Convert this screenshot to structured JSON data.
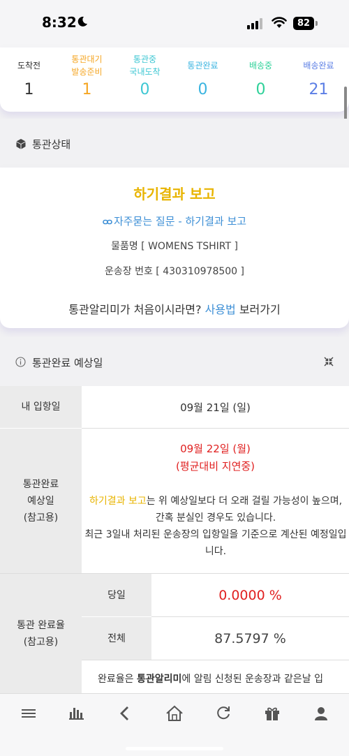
{
  "status_bar": {
    "time": "8:32",
    "battery": "82"
  },
  "stats": [
    {
      "label": "도착전",
      "value": "1",
      "color": "#333333"
    },
    {
      "label": "통관대기\n발송준비",
      "value": "1",
      "color": "#f5a623"
    },
    {
      "label": "통관중\n국내도착",
      "value": "0",
      "color": "#3ec7d3"
    },
    {
      "label": "통관완료",
      "value": "0",
      "color": "#3ab4e0"
    },
    {
      "label": "배송중",
      "value": "0",
      "color": "#2fd199"
    },
    {
      "label": "배송완료",
      "value": "21",
      "color": "#5b7ee5"
    }
  ],
  "status_section": {
    "header": "통관상태",
    "title": "하기결과 보고",
    "faq_link": "자주묻는 질문 - 하기결과 보고",
    "item_name": "물품명 [ WOMENS TSHIRT ]",
    "tracking": "운송장 번호 [ 430310978500 ]",
    "guide_prefix": "통관알리미가 처음이시라면? ",
    "guide_link": "사용법",
    "guide_suffix": " 보러가기"
  },
  "estimate_section": {
    "header": "통관완료 예상일",
    "arrival_label": "내 입항일",
    "arrival_value": "09월 21일 (일)",
    "estimate_label": "통관완료\n예상일\n(참고용)",
    "estimate_date": "09월 22일 (월)",
    "estimate_delay": "(평균대비 지연중)",
    "note_highlight": "하기결과 보고",
    "note_text": "는 위 예상일보다 더 오래 걸릴 가능성이 높으며, 간혹 분실인 경우도 있습니다.",
    "note_text2": "최근 3일내 처리된 운송장의 입항일을 기준으로 계산된 예정일입니다.",
    "rate_label": "통관 완료율\n(참고용)",
    "sameday_label": "당일",
    "sameday_value": "0.0000 %",
    "total_label": "전체",
    "total_value": "87.5797 %",
    "rate_note_prefix": "완료율은 ",
    "rate_note_bold": "통관알리미",
    "rate_note_suffix": "에 알림 신청된 운송장과 같은날 입"
  },
  "colors": {
    "accent_yellow": "#e8b400",
    "link_blue": "#3d8fd6",
    "alert_red": "#e02020"
  },
  "nav_icons": [
    "menu-icon",
    "chart-icon",
    "back-icon",
    "home-icon",
    "refresh-icon",
    "gift-icon",
    "user-icon"
  ]
}
